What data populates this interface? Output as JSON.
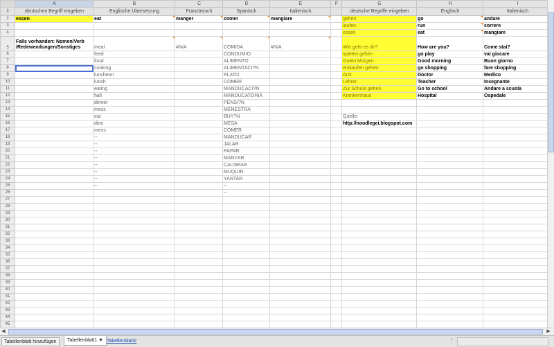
{
  "sheet": {
    "columns": [
      "A",
      "B",
      "C",
      "D",
      "E",
      "F",
      "G",
      "H",
      "I"
    ],
    "column_labels": [
      "deutschen Begriff eingeben",
      "Englische Übersetzung",
      "Französisch",
      "Spanisch",
      "Italienisch",
      "",
      "deutsche Begriffe eingeben",
      "Englisch",
      "Italienisch"
    ],
    "rows": [
      {
        "n": "2",
        "cells": [
          {
            "t": "essen",
            "y": 1,
            "b": 1
          },
          {
            "t": "eat",
            "b": 1,
            "m": 1
          },
          {
            "t": "manger",
            "b": 1,
            "m": 1
          },
          {
            "t": "comer",
            "b": 1,
            "m": 1
          },
          {
            "t": "mangiare",
            "b": 1,
            "m": 1
          },
          {
            "t": ""
          },
          {
            "t": "gehen",
            "y": 1
          },
          {
            "t": "go",
            "b": 1,
            "m": 1
          },
          {
            "t": "andare",
            "b": 1,
            "m": 1
          }
        ]
      },
      {
        "n": "3",
        "cells": [
          {
            "t": ""
          },
          {
            "t": ""
          },
          {
            "t": ""
          },
          {
            "t": ""
          },
          {
            "t": ""
          },
          {
            "t": ""
          },
          {
            "t": "laufen",
            "y": 1
          },
          {
            "t": "run",
            "b": 1,
            "m": 1
          },
          {
            "t": "correre",
            "b": 1,
            "m": 1
          }
        ]
      },
      {
        "n": "4",
        "cells": [
          {
            "t": ""
          },
          {
            "t": ""
          },
          {
            "t": ""
          },
          {
            "t": ""
          },
          {
            "t": ""
          },
          {
            "t": ""
          },
          {
            "t": "essen",
            "y": 1
          },
          {
            "t": "eat",
            "b": 1,
            "m": 1
          },
          {
            "t": "mangiare",
            "b": 1,
            "m": 1
          }
        ]
      },
      {
        "n": "5",
        "tall": 1,
        "cells": [
          {
            "t": "Falls vorhanden: Nomen/Verb /Redewendungen/Sonstiges",
            "b": 1
          },
          {
            "t": "meal",
            "muted": 1,
            "m": 1
          },
          {
            "t": "#N/A",
            "muted": 1,
            "m": 1
          },
          {
            "t": "COMIDA",
            "muted": 1,
            "m": 1
          },
          {
            "t": "#N/A",
            "muted": 1,
            "m": 1
          },
          {
            "t": ""
          },
          {
            "t": "Wie geht es dir?",
            "y": 1
          },
          {
            "t": "How are you?",
            "b": 1
          },
          {
            "t": "Come stai?",
            "b": 1,
            "m": 1
          }
        ]
      },
      {
        "n": "6",
        "cells": [
          {
            "t": ""
          },
          {
            "t": "feed",
            "muted": 1
          },
          {
            "t": ""
          },
          {
            "t": "CONDUMIO",
            "muted": 1
          },
          {
            "t": ""
          },
          {
            "t": ""
          },
          {
            "t": "spielen gehen",
            "y": 1
          },
          {
            "t": "go play",
            "b": 1
          },
          {
            "t": "vai giocare",
            "b": 1,
            "m": 1
          }
        ]
      },
      {
        "n": "7",
        "cells": [
          {
            "t": ""
          },
          {
            "t": "food",
            "muted": 1
          },
          {
            "t": ""
          },
          {
            "t": "ALIMENTO",
            "muted": 1
          },
          {
            "t": ""
          },
          {
            "t": ""
          },
          {
            "t": "Guten Morgen",
            "y": 1
          },
          {
            "t": "Good morning",
            "b": 1
          },
          {
            "t": "Buon giorno",
            "b": 1,
            "m": 1
          }
        ]
      },
      {
        "n": "8",
        "active": 1,
        "cells": [
          {
            "t": "",
            "active": 1
          },
          {
            "t": "cooking",
            "muted": 1
          },
          {
            "t": ""
          },
          {
            "t": "ALIMENTACI?N",
            "muted": 1
          },
          {
            "t": ""
          },
          {
            "t": ""
          },
          {
            "t": "einkaufen gehen",
            "y": 1
          },
          {
            "t": "go shopping",
            "b": 1
          },
          {
            "t": "fare shopping",
            "b": 1,
            "m": 1
          }
        ]
      },
      {
        "n": "9",
        "cells": [
          {
            "t": ""
          },
          {
            "t": "luncheon",
            "muted": 1
          },
          {
            "t": ""
          },
          {
            "t": "PLATO",
            "muted": 1
          },
          {
            "t": ""
          },
          {
            "t": ""
          },
          {
            "t": "Arzt",
            "y": 1
          },
          {
            "t": "Doctor",
            "b": 1
          },
          {
            "t": "Medico",
            "b": 1,
            "m": 1
          }
        ]
      },
      {
        "n": "10",
        "cells": [
          {
            "t": ""
          },
          {
            "t": "lunch",
            "muted": 1
          },
          {
            "t": ""
          },
          {
            "t": "COMER",
            "muted": 1
          },
          {
            "t": ""
          },
          {
            "t": ""
          },
          {
            "t": "Lehrer",
            "y": 1
          },
          {
            "t": "Teacher",
            "b": 1
          },
          {
            "t": "Insegnante",
            "b": 1,
            "m": 1
          }
        ]
      },
      {
        "n": "11",
        "cells": [
          {
            "t": ""
          },
          {
            "t": "eating",
            "muted": 1
          },
          {
            "t": ""
          },
          {
            "t": "MANDUCACI?N",
            "muted": 1
          },
          {
            "t": ""
          },
          {
            "t": ""
          },
          {
            "t": "Zur Schule gehen",
            "y": 1
          },
          {
            "t": "Go to school",
            "b": 1
          },
          {
            "t": "Andare a scuola",
            "b": 1,
            "m": 1
          }
        ]
      },
      {
        "n": "12",
        "cells": [
          {
            "t": ""
          },
          {
            "t": "hall",
            "muted": 1
          },
          {
            "t": ""
          },
          {
            "t": "MANDUCATORIA",
            "muted": 1
          },
          {
            "t": ""
          },
          {
            "t": ""
          },
          {
            "t": "Krankenhaus",
            "y": 1
          },
          {
            "t": "Hospital",
            "b": 1
          },
          {
            "t": "Ospedale",
            "b": 1,
            "m": 1
          }
        ]
      },
      {
        "n": "13",
        "cells": [
          {
            "t": ""
          },
          {
            "t": "dinner",
            "muted": 1
          },
          {
            "t": ""
          },
          {
            "t": "PENSI?N",
            "muted": 1
          },
          {
            "t": ""
          },
          {
            "t": ""
          },
          {
            "t": ""
          },
          {
            "t": ""
          },
          {
            "t": ""
          }
        ]
      },
      {
        "n": "14",
        "cells": [
          {
            "t": ""
          },
          {
            "t": "mess",
            "muted": 1
          },
          {
            "t": ""
          },
          {
            "t": "MENESTRA",
            "muted": 1
          },
          {
            "t": ""
          },
          {
            "t": ""
          },
          {
            "t": ""
          },
          {
            "t": ""
          },
          {
            "t": ""
          }
        ]
      },
      {
        "n": "15",
        "cells": [
          {
            "t": ""
          },
          {
            "t": "eat",
            "muted": 1
          },
          {
            "t": ""
          },
          {
            "t": "BUY?N",
            "muted": 1
          },
          {
            "t": ""
          },
          {
            "t": ""
          },
          {
            "t": "Quelle:",
            "muted": 1
          },
          {
            "t": ""
          },
          {
            "t": ""
          }
        ]
      },
      {
        "n": "16",
        "cells": [
          {
            "t": ""
          },
          {
            "t": "dine",
            "muted": 1
          },
          {
            "t": ""
          },
          {
            "t": "MESA",
            "muted": 1
          },
          {
            "t": ""
          },
          {
            "t": ""
          },
          {
            "t": "http://noodlegei.blogspot.com",
            "b": 1
          },
          {
            "t": ""
          },
          {
            "t": ""
          }
        ]
      },
      {
        "n": "17",
        "cells": [
          {
            "t": ""
          },
          {
            "t": "mess",
            "muted": 1
          },
          {
            "t": ""
          },
          {
            "t": "COMER",
            "muted": 1
          },
          {
            "t": ""
          },
          {
            "t": ""
          },
          {
            "t": ""
          },
          {
            "t": ""
          },
          {
            "t": ""
          }
        ]
      },
      {
        "n": "18",
        "cells": [
          {
            "t": ""
          },
          {
            "t": "--",
            "muted": 1
          },
          {
            "t": ""
          },
          {
            "t": "MANDUCAR",
            "muted": 1
          },
          {
            "t": ""
          },
          {
            "t": ""
          },
          {
            "t": ""
          },
          {
            "t": ""
          },
          {
            "t": ""
          }
        ]
      },
      {
        "n": "19",
        "cells": [
          {
            "t": ""
          },
          {
            "t": "--",
            "muted": 1
          },
          {
            "t": ""
          },
          {
            "t": "JALAR",
            "muted": 1
          },
          {
            "t": ""
          },
          {
            "t": ""
          },
          {
            "t": ""
          },
          {
            "t": ""
          },
          {
            "t": ""
          }
        ]
      },
      {
        "n": "20",
        "cells": [
          {
            "t": ""
          },
          {
            "t": "--",
            "muted": 1
          },
          {
            "t": ""
          },
          {
            "t": "PAPAR",
            "muted": 1
          },
          {
            "t": ""
          },
          {
            "t": ""
          },
          {
            "t": ""
          },
          {
            "t": ""
          },
          {
            "t": ""
          }
        ]
      },
      {
        "n": "21",
        "cells": [
          {
            "t": ""
          },
          {
            "t": "--",
            "muted": 1
          },
          {
            "t": ""
          },
          {
            "t": "MANYAR",
            "muted": 1
          },
          {
            "t": ""
          },
          {
            "t": ""
          },
          {
            "t": ""
          },
          {
            "t": ""
          },
          {
            "t": ""
          }
        ]
      },
      {
        "n": "22",
        "cells": [
          {
            "t": ""
          },
          {
            "t": "--",
            "muted": 1
          },
          {
            "t": ""
          },
          {
            "t": "CAUSEAR",
            "muted": 1
          },
          {
            "t": ""
          },
          {
            "t": ""
          },
          {
            "t": ""
          },
          {
            "t": ""
          },
          {
            "t": ""
          }
        ]
      },
      {
        "n": "23",
        "cells": [
          {
            "t": ""
          },
          {
            "t": "--",
            "muted": 1
          },
          {
            "t": ""
          },
          {
            "t": "MUQUIR",
            "muted": 1
          },
          {
            "t": ""
          },
          {
            "t": ""
          },
          {
            "t": ""
          },
          {
            "t": ""
          },
          {
            "t": ""
          }
        ]
      },
      {
        "n": "24",
        "cells": [
          {
            "t": ""
          },
          {
            "t": "--",
            "muted": 1
          },
          {
            "t": ""
          },
          {
            "t": "YANTAR",
            "muted": 1
          },
          {
            "t": ""
          },
          {
            "t": ""
          },
          {
            "t": ""
          },
          {
            "t": ""
          },
          {
            "t": ""
          }
        ]
      },
      {
        "n": "25",
        "cells": [
          {
            "t": ""
          },
          {
            "t": "--",
            "muted": 1
          },
          {
            "t": ""
          },
          {
            "t": "--",
            "muted": 1
          },
          {
            "t": ""
          },
          {
            "t": ""
          },
          {
            "t": ""
          },
          {
            "t": ""
          },
          {
            "t": ""
          }
        ]
      },
      {
        "n": "26",
        "cells": [
          {
            "t": ""
          },
          {
            "t": ""
          },
          {
            "t": ""
          },
          {
            "t": "--",
            "muted": 1
          },
          {
            "t": ""
          },
          {
            "t": ""
          },
          {
            "t": ""
          },
          {
            "t": ""
          },
          {
            "t": ""
          }
        ]
      },
      {
        "n": "27",
        "cells": []
      },
      {
        "n": "28",
        "cells": []
      },
      {
        "n": "29",
        "cells": []
      },
      {
        "n": "30",
        "cells": []
      },
      {
        "n": "31",
        "cells": []
      },
      {
        "n": "32",
        "cells": []
      },
      {
        "n": "33",
        "cells": []
      },
      {
        "n": "34",
        "cells": []
      },
      {
        "n": "35",
        "cells": []
      },
      {
        "n": "36",
        "cells": []
      },
      {
        "n": "37",
        "cells": []
      },
      {
        "n": "38",
        "cells": []
      },
      {
        "n": "39",
        "cells": []
      },
      {
        "n": "40",
        "cells": []
      },
      {
        "n": "41",
        "cells": []
      },
      {
        "n": "42",
        "cells": []
      },
      {
        "n": "43",
        "cells": []
      },
      {
        "n": "44",
        "cells": []
      },
      {
        "n": "45",
        "cells": []
      },
      {
        "n": "46",
        "cells": []
      }
    ]
  },
  "tabbar": {
    "add_sheet_label": "Tabellenblatt hinzufügen",
    "active_tab_label": "Tabellenblatt1 ▼",
    "second_tab_label": "Tabellenblatt2"
  },
  "colors": {
    "yellow": "#ffff33",
    "accent": "#4a6fd0",
    "link": "#1a4db3"
  }
}
